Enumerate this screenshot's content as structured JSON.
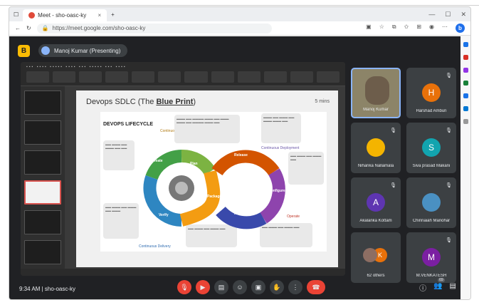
{
  "browser": {
    "tab_title": "Meet - sho-oasc-ky",
    "url": "https://meet.google.com/sho-oasc-ky"
  },
  "header": {
    "presenter": "Manoj Kumar (Presenting)"
  },
  "slide": {
    "title_prefix": "Devops SDLC (The",
    "title_emph": "Blue Print",
    "title_suffix": ")",
    "time": "5 mins",
    "lifecycle_title": "DEVOPS LIFECYCLE",
    "stages": [
      "Create",
      "Plan",
      "Release",
      "Configure",
      "Monitor",
      "Verify",
      "Package"
    ],
    "section_labels": {
      "integration": "Continuous Integration",
      "deployment": "Continuous Deployment",
      "delivery": "Continuous Delivery",
      "operate": "Operate"
    }
  },
  "participants": [
    {
      "name": "Manoj Kumar",
      "initial": "",
      "color": "#8c8468",
      "speaking": true
    },
    {
      "name": "Harshad Amburi",
      "initial": "H",
      "color": "#e8710a",
      "speaking": false
    },
    {
      "name": "Niharika Nallamala",
      "initial": "",
      "color": "#3c4043",
      "speaking": false
    },
    {
      "name": "Siva prasad Makani",
      "initial": "S",
      "color": "#12a4af",
      "speaking": false
    },
    {
      "name": "Akalanka Kottam",
      "initial": "A",
      "color": "#5e35b1",
      "speaking": false
    },
    {
      "name": "Chinnaiah Manohar",
      "initial": "",
      "color": "#3c4043",
      "speaking": false
    },
    {
      "name": "62 others",
      "initial": "",
      "color": "#3c4043",
      "speaking": false
    },
    {
      "name": "M.VENKATESH",
      "initial": "M",
      "color": "#7b1fa2",
      "speaking": false
    }
  ],
  "controls": {
    "meeting_info": "9:34 AM | sho-oasc-ky",
    "participant_count": "69"
  }
}
